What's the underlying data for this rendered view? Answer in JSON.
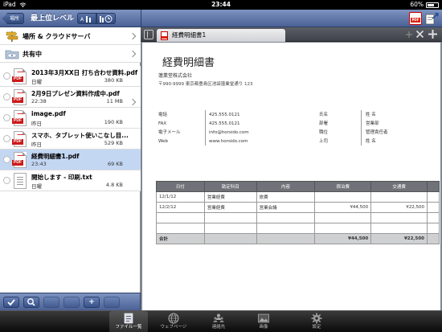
{
  "status_bar": {
    "device": "iPad",
    "time": "23:44",
    "battery": "60%"
  },
  "left_toolbar": {
    "back_label": "場所",
    "title": "最上位レベル"
  },
  "locations": [
    {
      "label": "場所 & クラウドサーバ"
    },
    {
      "label": "共有中"
    }
  ],
  "files": [
    {
      "name": "2013年3月XX日 打ち合わせ資料.pdf",
      "date": "日曜",
      "size": "380 KB",
      "type": "pdf"
    },
    {
      "name": "2月9日プレゼン資料作成中.pdf",
      "date": "22:38",
      "size": "11 MB",
      "type": "pdf"
    },
    {
      "name": "image.pdf",
      "date": "昨日",
      "size": "190 KB",
      "type": "pdf"
    },
    {
      "name": "スマホ、タブレット使いこなし目...",
      "date": "昨日",
      "size": "529 KB",
      "type": "pdf"
    },
    {
      "name": "経費明細書1.pdf",
      "date": "23:43",
      "size": "69 KB",
      "type": "pdf",
      "selected": true
    },
    {
      "name": "開始します - 印刷.txt",
      "date": "日曜",
      "size": "4.8 KB",
      "type": "txt"
    }
  ],
  "left_bottom": {
    "add_label": "+"
  },
  "doc_tab": {
    "label": "経費明細書1"
  },
  "document": {
    "title": "経費明細書",
    "company": "蓮業堂株式会社",
    "address": "〒990-9999 東京都豊島区池袋蓮業堂通り 123",
    "contact_labels": [
      "電話",
      "FAX",
      "電子メール",
      "Web"
    ],
    "contact_values": [
      "425.555.0121",
      "425.555.0121",
      "info@horsido.com",
      "www.horsido.com"
    ],
    "person_labels": [
      "氏名",
      "部署",
      "職位",
      "上司"
    ],
    "person_values": [
      "姓 名",
      "営業部",
      "管理責任者",
      "姓 名"
    ],
    "table": {
      "headers": [
        "日付",
        "勘定科目",
        "内容",
        "宿泊費",
        "交通費",
        ""
      ],
      "rows": [
        [
          "12/1/12",
          "営業経費",
          "旅費",
          "",
          "",
          ""
        ],
        [
          "12/2/12",
          "営業経費",
          "営業会議",
          "¥44,500",
          "¥22,500",
          ""
        ],
        [
          "",
          "",
          "",
          "",
          "",
          ""
        ],
        [
          "",
          "",
          "",
          "",
          "",
          ""
        ]
      ],
      "total": [
        "合計",
        "",
        "",
        "¥44,500",
        "¥22,500",
        ""
      ]
    }
  },
  "tab_bar": [
    {
      "label": "ファイル一覧",
      "icon": "file-list-icon",
      "active": true
    },
    {
      "label": "ウェブページ",
      "icon": "globe-icon",
      "active": false
    },
    {
      "label": "連絡先",
      "icon": "contacts-icon",
      "active": false
    },
    {
      "label": "画像",
      "icon": "image-icon",
      "active": false
    },
    {
      "label": "設定",
      "icon": "gear-icon",
      "active": false
    }
  ]
}
